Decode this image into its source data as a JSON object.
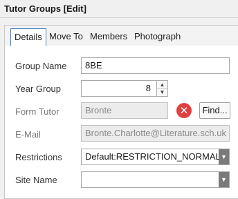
{
  "window": {
    "title": "Tutor Groups [Edit]"
  },
  "tabs": [
    {
      "label": "Details"
    },
    {
      "label": "Move To"
    },
    {
      "label": "Members"
    },
    {
      "label": "Photograph"
    }
  ],
  "form": {
    "group_name": {
      "label": "Group Name",
      "value": "8BE"
    },
    "year_group": {
      "label": "Year Group",
      "value": "8"
    },
    "form_tutor": {
      "label": "Form Tutor",
      "value": "Bronte",
      "clear_icon": "clear-x-icon",
      "find_label": "Find..."
    },
    "email": {
      "label": "E-Mail",
      "value": "Bronte.Charlotte@Literature.sch.uk"
    },
    "restrictions": {
      "label": "Restrictions",
      "value": "Default:RESTRICTION_NORMAL"
    },
    "site_name": {
      "label": "Site Name",
      "value": ""
    }
  },
  "colors": {
    "accent": "#3c7fc4",
    "clear": "#e04040"
  }
}
